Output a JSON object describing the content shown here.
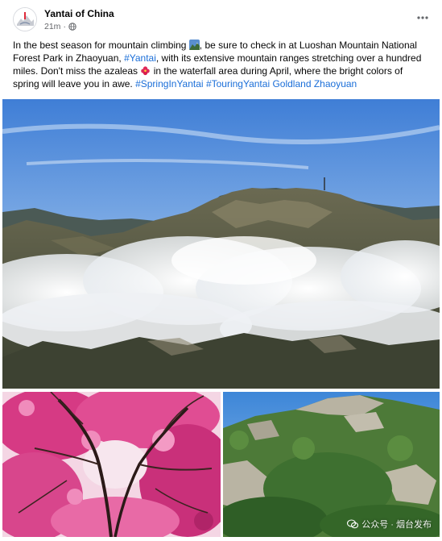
{
  "post": {
    "author": "Yantai of China",
    "time": "21m",
    "audience_icon": "globe-icon",
    "text_1": "In the best season for mountain climbing ",
    "text_2": ", be sure to check in at Luoshan Mountain National Forest Park in Zhaoyuan, ",
    "hashtag_yantai": "#Yantai",
    "text_3": ", with its extensive mountain ranges stretching over a hundred miles. Don't miss the azaleas ",
    "text_4": " in the waterfall area during April, where the bright colors of spring will leave you in awe. ",
    "hashtag_spring": "#SpringInYantai",
    "hashtag_touring": "#TouringYantai",
    "hashtag_goldland": "Goldland",
    "hashtag_zhaoyuan": "Zhaoyuan",
    "emoji_1": "mountain-emoji",
    "emoji_2": "azalea-flower-emoji"
  },
  "photos": [
    {
      "name": "mountain-clouds-photo"
    },
    {
      "name": "azalea-blossoms-photo"
    },
    {
      "name": "green-rocky-mountain-photo"
    }
  ],
  "watermark": {
    "text": "公众号 · 烟台发布"
  },
  "colors": {
    "hashtag": "#1a6ed8",
    "sky": "#4a86d6",
    "azalea": "#d0307a"
  }
}
